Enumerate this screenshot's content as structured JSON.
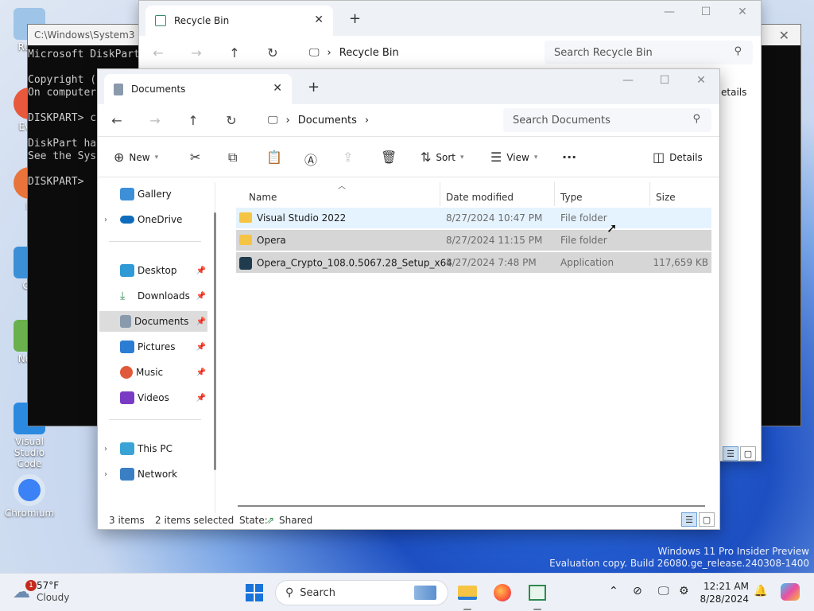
{
  "desktop": {
    "icons": [
      {
        "label": "Recy",
        "color": "#9ec4e8"
      },
      {
        "label": "Ever",
        "color": "#e8583c"
      },
      {
        "label": "Fi",
        "color": "#e8743c"
      },
      {
        "label": "Git",
        "color": "#3b8fd6"
      },
      {
        "label": "Note",
        "color": "#6ab04c"
      },
      {
        "label": "Visual Studio Code",
        "color": "#2b8ae0"
      },
      {
        "label": "Chromium",
        "color": "#3b82f6"
      }
    ]
  },
  "cmd": {
    "title": "C:\\Windows\\System3",
    "lines": [
      "Microsoft DiskPart",
      "",
      "Copyright (",
      "On computer",
      "",
      "DISKPART> c",
      "",
      "DiskPart ha",
      "See the Sys",
      "",
      "DISKPART>"
    ]
  },
  "recycle": {
    "tab_title": "Recycle Bin",
    "address": "Recycle Bin",
    "search_placeholder": "Search Recycle Bin",
    "details_partial": "etails"
  },
  "documents": {
    "tab_title": "Documents",
    "address": "Documents",
    "search_placeholder": "Search Documents",
    "toolbar": {
      "new": "New",
      "sort": "Sort",
      "view": "View",
      "more": "···",
      "details": "Details"
    },
    "nav": {
      "gallery": "Gallery",
      "onedrive": "OneDrive",
      "desktop": "Desktop",
      "downloads": "Downloads",
      "documents": "Documents",
      "pictures": "Pictures",
      "music": "Music",
      "videos": "Videos",
      "thispc": "This PC",
      "network": "Network"
    },
    "columns": {
      "name": "Name",
      "date": "Date modified",
      "type": "Type",
      "size": "Size"
    },
    "files": [
      {
        "name": "Visual Studio 2022",
        "date": "8/27/2024 10:47 PM",
        "type": "File folder",
        "size": ""
      },
      {
        "name": "Opera",
        "date": "8/27/2024 11:15 PM",
        "type": "File folder",
        "size": ""
      },
      {
        "name": "Opera_Crypto_108.0.5067.28_Setup_x64",
        "date": "8/27/2024 7:48 PM",
        "type": "Application",
        "size": "117,659 KB"
      }
    ],
    "status": {
      "count": "3 items",
      "selected": "2 items selected",
      "state_label": "State:",
      "state_value": "Shared"
    }
  },
  "watermark": {
    "line1": "Windows 11 Pro Insider Preview",
    "line2": "Evaluation copy. Build 26080.ge_release.240308-1400"
  },
  "taskbar": {
    "temp": "57°F",
    "condition": "Cloudy",
    "badge": "1",
    "search": "Search",
    "time": "12:21 AM",
    "date": "8/28/2024"
  }
}
